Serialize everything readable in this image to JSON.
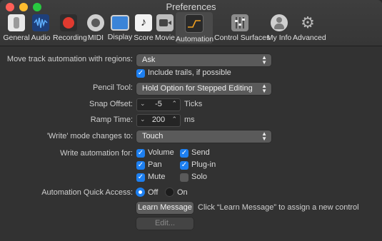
{
  "window": {
    "title": "Preferences"
  },
  "toolbar": {
    "items": [
      {
        "label": "General"
      },
      {
        "label": "Audio"
      },
      {
        "label": "Recording"
      },
      {
        "label": "MIDI"
      },
      {
        "label": "Display"
      },
      {
        "label": "Score"
      },
      {
        "label": "Movie"
      },
      {
        "label": "Automation"
      },
      {
        "label": "Control Surfaces"
      },
      {
        "label": "My Info"
      },
      {
        "label": "Advanced"
      }
    ],
    "selected": "Automation"
  },
  "form": {
    "move_track": {
      "label": "Move track automation with regions:",
      "value": "Ask"
    },
    "include_trails": {
      "label": "Include trails, if possible",
      "checked": true
    },
    "pencil_tool": {
      "label": "Pencil Tool:",
      "value": "Hold Option for Stepped Editing"
    },
    "snap_offset": {
      "label": "Snap Offset:",
      "value": "-5",
      "unit": "Ticks"
    },
    "ramp_time": {
      "label": "Ramp Time:",
      "value": "200",
      "unit": "ms"
    },
    "write_mode": {
      "label": "'Write' mode changes to:",
      "value": "Touch"
    },
    "write_automation": {
      "label": "Write automation for:",
      "options": [
        {
          "label": "Volume",
          "checked": true
        },
        {
          "label": "Send",
          "checked": true
        },
        {
          "label": "Pan",
          "checked": true
        },
        {
          "label": "Plug-in",
          "checked": true
        },
        {
          "label": "Mute",
          "checked": true
        },
        {
          "label": "Solo",
          "checked": false
        }
      ]
    },
    "quick_access": {
      "label": "Automation Quick Access:",
      "off_label": "Off",
      "on_label": "On",
      "selected": "Off"
    },
    "learn_button": "Learn Message",
    "learn_hint": "Click “Learn Message” to assign a new control",
    "edit_button": "Edit..."
  },
  "colors": {
    "accent": "#1d7ff0",
    "window_bg": "#323232"
  }
}
